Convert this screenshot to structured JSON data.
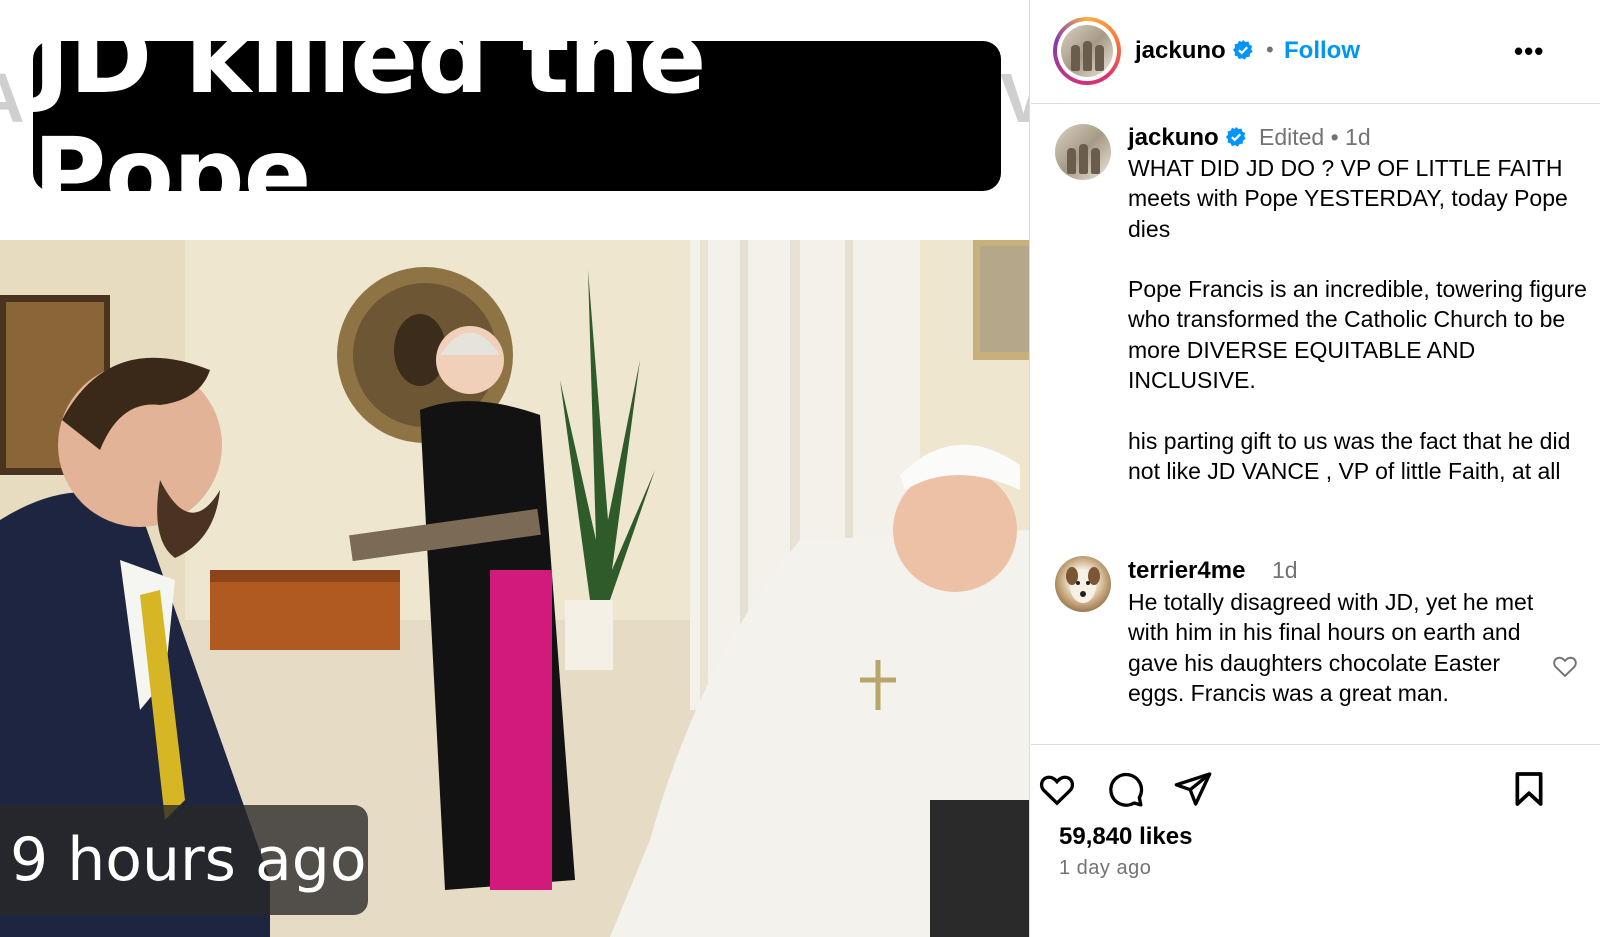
{
  "media": {
    "headline": "JD killed the Pope",
    "ghost_left": "A",
    "ghost_right": "V",
    "timestamp_overlay": "9 hours ago"
  },
  "header": {
    "username": "jackuno",
    "separator": "•",
    "follow_label": "Follow",
    "more_label": "•••"
  },
  "post": {
    "username": "jackuno",
    "meta": "Edited • 1d",
    "caption": [
      "WHAT DID JD DO ? VP OF LITTLE FAITH meets with Pope YESTERDAY, today Pope dies",
      "Pope Francis is an incredible, towering figure who transformed the Catholic Church to be more DIVERSE EQUITABLE AND INCLUSIVE.",
      "his parting gift to us was the fact that he did not like JD VANCE , VP of little Faith, at all"
    ]
  },
  "comment": {
    "username": "terrier4me",
    "time": "1d",
    "text": "He totally disagreed with JD, yet he met with him in his final hours on earth and gave his daughters chocolate Easter eggs. Francis was a great man."
  },
  "footer": {
    "likes": "59,840 likes",
    "posted": "1 day ago"
  },
  "colors": {
    "follow_blue": "#0095f6",
    "muted_gray": "#737373",
    "verified_blue": "#0095f6",
    "sash_magenta": "#d2197c"
  },
  "icons": [
    "verified-badge-icon",
    "heart-icon",
    "comment-icon",
    "share-icon",
    "bookmark-icon",
    "more-icon"
  ]
}
